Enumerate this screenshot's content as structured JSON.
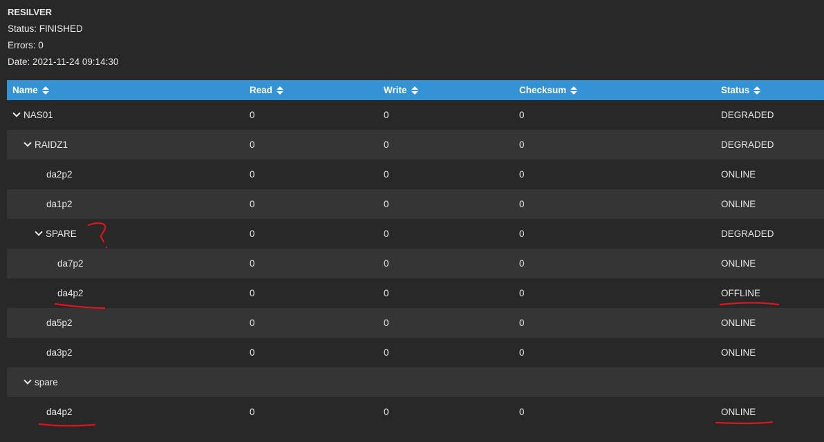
{
  "summary": {
    "title": "RESILVER",
    "status": "Status: FINISHED",
    "errors": "Errors: 0",
    "date": "Date: 2021-11-24 09:14:30"
  },
  "table": {
    "columns": [
      {
        "label": "Name"
      },
      {
        "label": "Read"
      },
      {
        "label": "Write"
      },
      {
        "label": "Checksum"
      },
      {
        "label": "Status"
      }
    ],
    "rows": [
      {
        "name": "NAS01",
        "level": 0,
        "expandable": true,
        "read": "0",
        "write": "0",
        "checksum": "0",
        "status": "DEGRADED"
      },
      {
        "name": "RAIDZ1",
        "level": 1,
        "expandable": true,
        "read": "0",
        "write": "0",
        "checksum": "0",
        "status": "DEGRADED"
      },
      {
        "name": "da2p2",
        "level": 2,
        "expandable": false,
        "read": "0",
        "write": "0",
        "checksum": "0",
        "status": "ONLINE"
      },
      {
        "name": "da1p2",
        "level": 2,
        "expandable": false,
        "read": "0",
        "write": "0",
        "checksum": "0",
        "status": "ONLINE"
      },
      {
        "name": "SPARE",
        "level": 2,
        "expandable": true,
        "read": "0",
        "write": "0",
        "checksum": "0",
        "status": "DEGRADED"
      },
      {
        "name": "da7p2",
        "level": 3,
        "expandable": false,
        "read": "0",
        "write": "0",
        "checksum": "0",
        "status": "ONLINE"
      },
      {
        "name": "da4p2",
        "level": 3,
        "expandable": false,
        "read": "0",
        "write": "0",
        "checksum": "0",
        "status": "OFFLINE"
      },
      {
        "name": "da5p2",
        "level": 2,
        "expandable": false,
        "read": "0",
        "write": "0",
        "checksum": "0",
        "status": "ONLINE"
      },
      {
        "name": "da3p2",
        "level": 2,
        "expandable": false,
        "read": "0",
        "write": "0",
        "checksum": "0",
        "status": "ONLINE"
      },
      {
        "name": "spare",
        "level": 1,
        "expandable": true,
        "read": "",
        "write": "",
        "checksum": "",
        "status": ""
      },
      {
        "name": "da4p2",
        "level": 2,
        "expandable": false,
        "read": "0",
        "write": "0",
        "checksum": "0",
        "status": "ONLINE"
      }
    ]
  },
  "colors": {
    "header_bg": "#3393d4",
    "row_dark": "#282828",
    "row_light": "#353535",
    "annotation": "#e0141c"
  },
  "icons": {
    "sort": "sort-icon",
    "expand": "chevron-down-icon"
  }
}
